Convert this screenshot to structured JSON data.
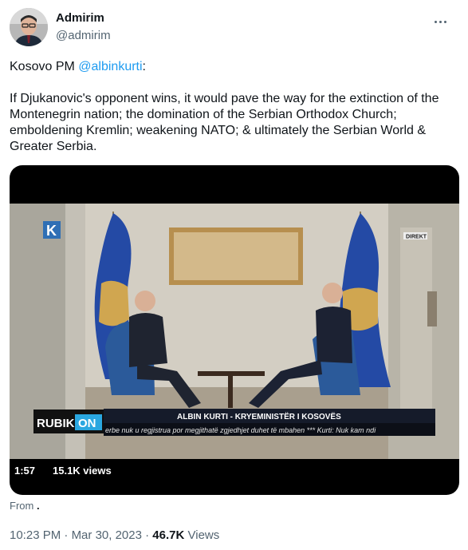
{
  "author": {
    "name": "Admirim",
    "handle": "@admirim"
  },
  "tweet": {
    "intro_prefix": "Kosovo PM ",
    "mention": "@albinkurti",
    "intro_suffix": ":",
    "body": "If Djukanovic's opponent wins, it would pave the way for the extinction of the Montenegrin nation; the domination of the Serbian Orthodox Church; emboldening Kremlin; weakening NATO; & ultimately the Serbian World & Greater Serbia."
  },
  "video": {
    "duration": "1:57",
    "views": "15.1K views",
    "channel_logo_text": "RUBIK",
    "channel_logo_on": "ON",
    "live_badge": "DIREKT",
    "lower_third_title": "ALBIN KURTI - KRYEMINISTËR I KOSOVËS",
    "ticker": "erbe nuk u regjistrua por megjithatë zgjedhjet duhet të mbahen *** Kurti: Nuk kam ndi"
  },
  "meta": {
    "from_label": "From",
    "from_source": ".",
    "time": "10:23 PM",
    "separator": "·",
    "date": "Mar 30, 2023",
    "views_count": "46.7K",
    "views_label": "Views"
  },
  "colors": {
    "link": "#1d9bf0",
    "secondary_text": "#536471",
    "primary_text": "#0f1419",
    "kosovo_blue": "#244aa5",
    "kosovo_gold": "#d0a650"
  }
}
